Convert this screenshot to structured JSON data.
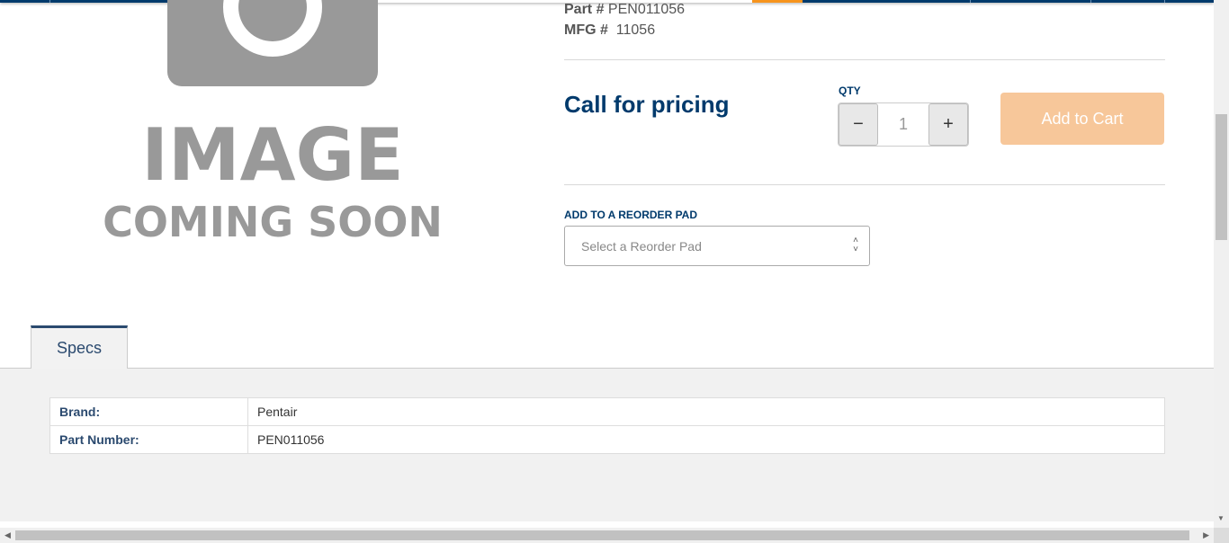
{
  "product": {
    "image_placeholder": {
      "line1": "IMAGE",
      "line2": "COMING SOON",
      "icon": "camera-icon"
    },
    "part_label": "Part #",
    "part_number": "PEN011056",
    "mfg_label": "MFG #",
    "mfg_number": "11056",
    "price_text": "Call for pricing"
  },
  "quantity": {
    "label": "QTY",
    "value": "1",
    "minus_glyph": "−",
    "plus_glyph": "+"
  },
  "add_to_cart": {
    "label": "Add to Cart",
    "color": "#f7c79a"
  },
  "reorder": {
    "label": "ADD TO A REORDER PAD",
    "placeholder": "Select a Reorder Pad"
  },
  "tabs": [
    {
      "label": "Specs",
      "active": true
    }
  ],
  "specs": [
    {
      "key": "Brand:",
      "value": "Pentair"
    },
    {
      "key": "Part Number:",
      "value": "PEN011056"
    }
  ],
  "colors": {
    "brand_navy": "#003a6c",
    "accent_orange": "#f7941d"
  }
}
